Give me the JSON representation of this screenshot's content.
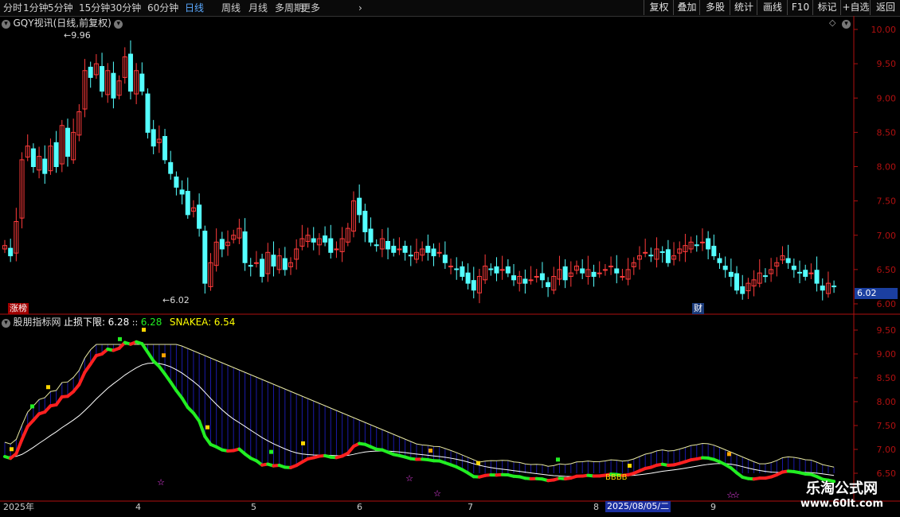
{
  "toolbar": {
    "periods": [
      "分时",
      "1分钟",
      "5分钟",
      "15分钟",
      "30分钟",
      "60分钟",
      "日线",
      "周线",
      "月线",
      "多周期",
      "更多"
    ],
    "active_period": "日线",
    "more_icon": "chevron-right-icon",
    "actions": [
      "复权",
      "叠加",
      "多股",
      "统计",
      "画线",
      "F10",
      "标记",
      "+自选",
      "返回"
    ]
  },
  "main_panel": {
    "title": "GQY视讯(日线,前复权)",
    "high_label": "9.96",
    "low_label": "6.02",
    "badge_limit_up": "涨榜",
    "badge_finance": "财",
    "current_price": "6.02",
    "y_ticks": [
      "10.00",
      "9.50",
      "9.00",
      "8.50",
      "8.00",
      "7.50",
      "7.00",
      "6.50",
      "6.00"
    ]
  },
  "indicator_panel": {
    "name": "股朋指标网",
    "label1": "止损下限:",
    "value1": "6.28",
    "value2": "6.28",
    "label2": "SNAKEA:",
    "value3": "6.54",
    "bbbb_label": "BBBB",
    "y_ticks": [
      "9.50",
      "9.00",
      "8.50",
      "8.00",
      "7.50",
      "7.00",
      "6.50"
    ]
  },
  "x_axis": {
    "labels": [
      "2025年",
      "4",
      "5",
      "6",
      "7",
      "8",
      "9"
    ],
    "cursor_date": "2025/08/05/二"
  },
  "watermark": {
    "line1": "乐淘公式网",
    "line2": "www.60lt.com"
  },
  "colors": {
    "up": "#ff3b3b",
    "down": "#54ffff",
    "axis": "#b01010",
    "green_line": "#22ee22",
    "red_line": "#ff2020",
    "band": "#1a1aa8"
  },
  "chart_data": {
    "type": "candlestick",
    "price_range": [
      6.0,
      10.1
    ],
    "ohlc_closes": [
      6.85,
      6.7,
      7.2,
      8.1,
      8.3,
      8.0,
      8.15,
      7.9,
      8.3,
      8.0,
      8.6,
      8.15,
      8.5,
      8.8,
      9.4,
      9.3,
      9.5,
      9.1,
      9.4,
      9.0,
      9.25,
      9.6,
      9.1,
      9.4,
      9.1,
      8.5,
      8.3,
      8.4,
      8.1,
      7.9,
      7.7,
      7.6,
      7.3,
      7.4,
      7.1,
      6.3,
      6.6,
      6.9,
      6.8,
      6.9,
      7.0,
      7.1,
      6.6,
      6.55,
      6.6,
      6.4,
      6.75,
      6.55,
      6.7,
      6.5,
      6.6,
      6.8,
      6.95,
      7.0,
      6.9,
      6.95,
      6.9,
      6.75,
      6.8,
      6.95,
      7.1,
      7.5,
      7.3,
      7.05,
      6.9,
      6.85,
      6.95,
      6.8,
      6.75,
      6.8,
      6.75,
      6.7,
      6.75,
      6.8,
      6.75,
      6.7,
      6.75,
      6.6,
      6.55,
      6.5,
      6.4,
      6.3,
      6.2,
      6.4,
      6.55,
      6.5,
      6.45,
      6.5,
      6.45,
      6.35,
      6.4,
      6.3,
      6.35,
      6.4,
      6.35,
      6.25,
      6.4,
      6.5,
      6.35,
      6.45,
      6.55,
      6.45,
      6.5,
      6.4,
      6.45,
      6.5,
      6.55,
      6.45,
      6.4,
      6.5,
      6.6,
      6.7,
      6.75,
      6.7,
      6.8,
      6.75,
      6.6,
      6.7,
      6.8,
      6.85,
      6.9,
      6.85,
      6.9,
      6.8,
      6.7,
      6.6,
      6.5,
      6.4,
      6.2,
      6.15,
      6.3,
      6.35,
      6.45,
      6.4,
      6.5,
      6.6,
      6.7,
      6.6,
      6.5,
      6.45,
      6.4,
      6.45,
      6.3,
      6.2,
      6.3,
      6.25
    ]
  }
}
